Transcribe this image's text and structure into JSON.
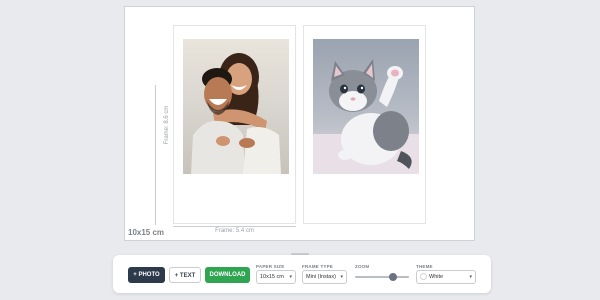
{
  "paper": {
    "size_label": "10x15 cm",
    "background": "#ffffff"
  },
  "frames": [
    {
      "subject": "smiling couple piggyback photo"
    },
    {
      "subject": "grey and white kitten raising paw"
    }
  ],
  "dimensions": {
    "height_label": "Frame: 8.6 cm",
    "width_label": "Frame: 5.4 cm"
  },
  "toolbar": {
    "photo_button": "+ PHOTO",
    "text_button": "+ TEXT",
    "download_button": "DOWNLOAD",
    "paper_size": {
      "label": "PAPER SIZE",
      "value": "10x15 cm"
    },
    "frame_type": {
      "label": "FRAME TYPE",
      "value": "Mini (Instax)"
    },
    "zoom": {
      "label": "ZOOM",
      "value": 0.7
    },
    "theme": {
      "label": "THEME",
      "value": "White",
      "swatch": "#ffffff"
    }
  },
  "colors": {
    "photo_button_bg": "#2c3a4b",
    "download_button_bg": "#2fa552",
    "canvas_bg": "#e8eaee"
  },
  "icons": {
    "dropdown": "chevron-down-icon",
    "theme_swatch": "color-swatch-icon"
  }
}
